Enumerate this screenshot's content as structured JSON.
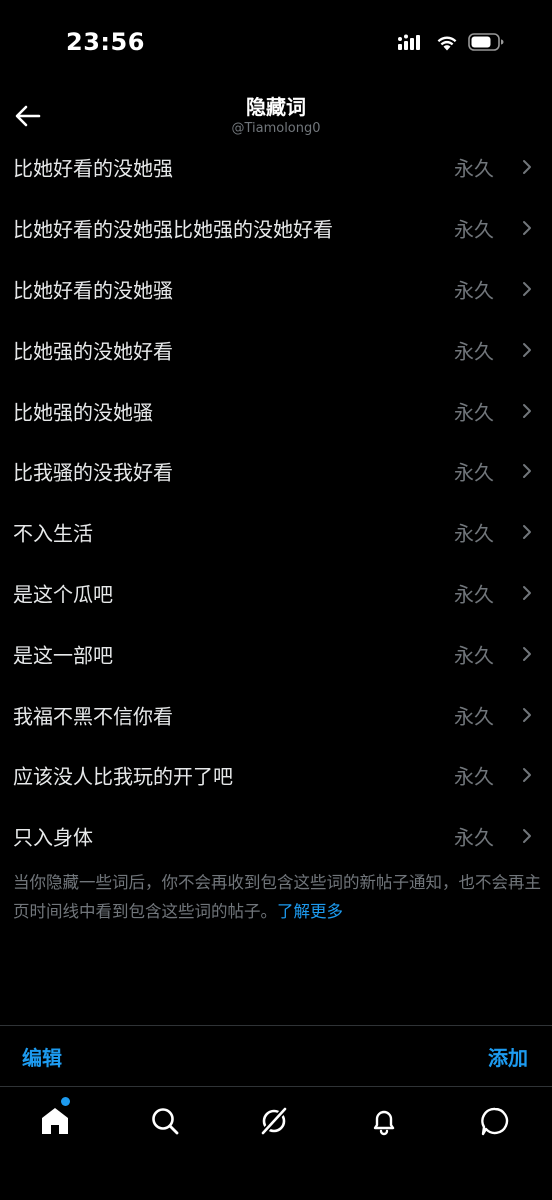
{
  "status_bar": {
    "time": "23:56"
  },
  "header": {
    "title": "隐藏词",
    "subtitle": "@Tiamolong0"
  },
  "muted_words": [
    {
      "word": "比她好看的没她强",
      "duration": "永久"
    },
    {
      "word": "比她好看的没她强比她强的没她好看",
      "duration": "永久"
    },
    {
      "word": "比她好看的没她骚",
      "duration": "永久"
    },
    {
      "word": "比她强的没她好看",
      "duration": "永久"
    },
    {
      "word": "比她强的没她骚",
      "duration": "永久"
    },
    {
      "word": "比我骚的没我好看",
      "duration": "永久"
    },
    {
      "word": "不入生活",
      "duration": "永久"
    },
    {
      "word": "是这个瓜吧",
      "duration": "永久"
    },
    {
      "word": "是这一部吧",
      "duration": "永久"
    },
    {
      "word": "我福不黑不信你看",
      "duration": "永久"
    },
    {
      "word": "应该没人比我玩的开了吧",
      "duration": "永久"
    },
    {
      "word": "只入身体",
      "duration": "永久"
    }
  ],
  "info": {
    "text": "当你隐藏一些词后，你不会再收到包含这些词的新帖子通知，也不会再主页时间线中看到包含这些词的帖子。",
    "learn_more": "了解更多"
  },
  "actions": {
    "edit": "编辑",
    "add": "添加"
  },
  "tabs": [
    {
      "name": "home-icon",
      "active": true,
      "has_notification_dot": true
    },
    {
      "name": "search-icon",
      "active": false
    },
    {
      "name": "grok-icon",
      "active": false
    },
    {
      "name": "bell-icon",
      "active": false
    },
    {
      "name": "message-icon",
      "active": false
    }
  ],
  "colors": {
    "background": "#000000",
    "text_primary": "#e7e9ea",
    "text_secondary": "#71767b",
    "accent": "#1d9bf0",
    "divider": "#2f3336"
  }
}
